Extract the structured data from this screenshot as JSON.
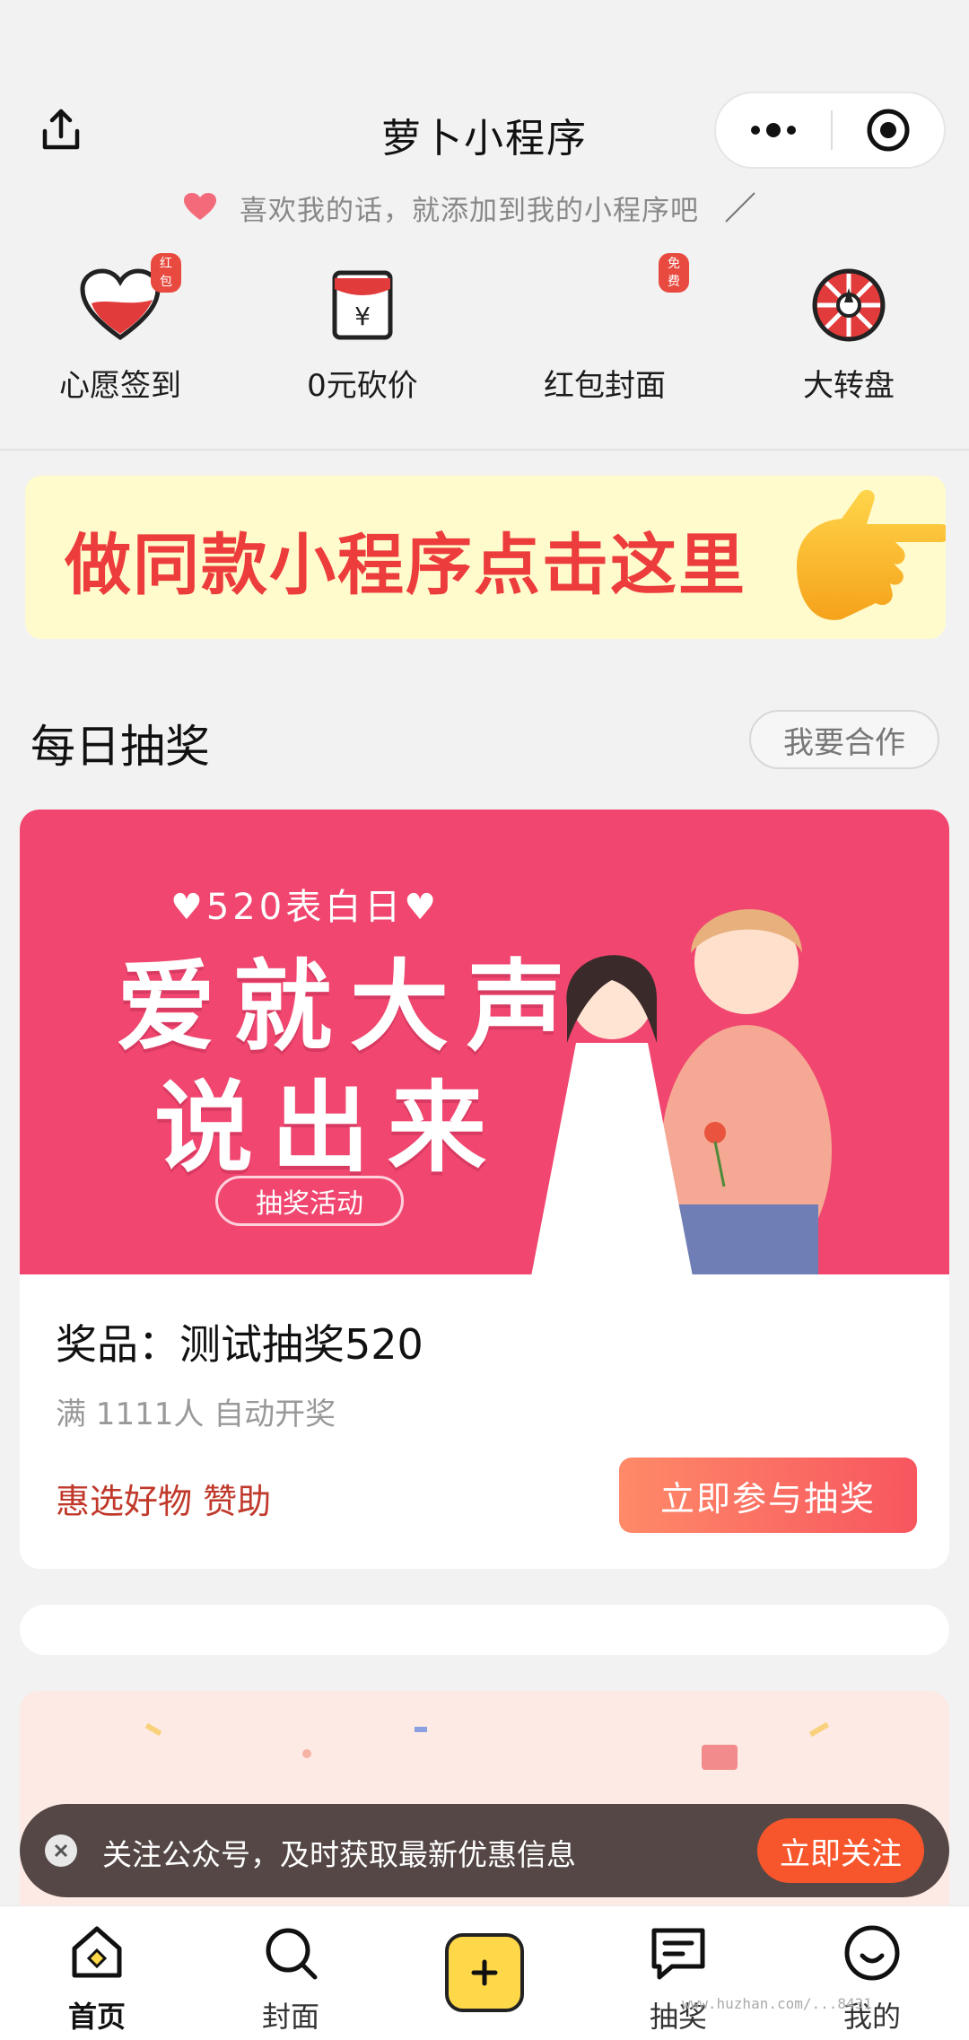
{
  "navbar": {
    "title": "萝卜小程序"
  },
  "add_tip": "喜欢我的话，就添加到我的小程序吧",
  "quick_entries": [
    {
      "label": "心愿签到",
      "badge": "红包",
      "icon": "heart-icon"
    },
    {
      "label": "0元砍价",
      "badge": "",
      "icon": "red-envelope-yen-icon"
    },
    {
      "label": "红包封面",
      "badge": "免费",
      "icon": ""
    },
    {
      "label": "大转盘",
      "badge": "",
      "icon": "wheel-icon"
    }
  ],
  "promo_banner": {
    "text": "做同款小程序点击这里",
    "icon": "pointing-hand-icon"
  },
  "section": {
    "title": "每日抽奖",
    "coop_button": "我要合作"
  },
  "lottery_card": {
    "image": {
      "small_title": "♥520表白日♥",
      "line1": "爱就大声",
      "line2": "说出来",
      "tag": "抽奖活动"
    },
    "prize": "奖品：测试抽奖520",
    "condition": "满 1111人 自动开奖",
    "sponsor": "惠选好物 赞助",
    "join_button": "立即参与抽奖"
  },
  "toast": {
    "message": "关注公众号，及时获取最新优惠信息",
    "follow_button": "立即关注"
  },
  "tabbar": {
    "tabs": [
      {
        "label": "首页",
        "icon": "home-icon",
        "active": true
      },
      {
        "label": "封面",
        "icon": "search-icon",
        "active": false
      },
      {
        "label": "",
        "icon": "plus-icon",
        "active": false
      },
      {
        "label": "抽奖",
        "icon": "message-icon",
        "active": false
      },
      {
        "label": "我的",
        "icon": "smile-icon",
        "active": false
      }
    ]
  },
  "watermark": "www.huzhan.com/...8431",
  "colors": {
    "accent_red": "#ec3c3c",
    "card_pink": "#f0466f",
    "button_orange": "#f7562c",
    "tab_yellow": "#ffd84a"
  }
}
